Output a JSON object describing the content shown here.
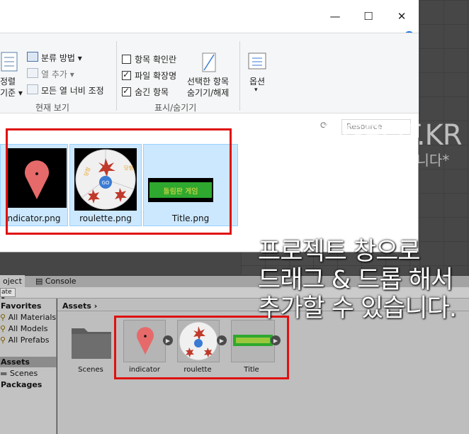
{
  "window": {
    "minimize": "—",
    "maximize": "☐",
    "close": "✕",
    "help": "?",
    "chevron": "∨"
  },
  "ribbon": {
    "sort_label_1": "정렬",
    "sort_label_2": "기준 ▾",
    "group_by": "분류 방법 ▾",
    "add_column": "열 추가 ▾",
    "fit_columns": "모든 열 너비 조정",
    "current_view": "현재 보기",
    "item_checkboxes": "항목 확인란",
    "file_extensions": "파일 확장명",
    "hidden_items": "숨긴 항목",
    "hide_selected_1": "선택한 항목",
    "hide_selected_2": "숨기기/해제",
    "show_hide": "표시/숨기기",
    "options": "옵션",
    "options_arrow": "▾"
  },
  "checkboxes": {
    "item_checkboxes": false,
    "file_extensions": true,
    "hidden_items": true
  },
  "search": {
    "placeholder": "Resource"
  },
  "files": [
    {
      "name": "ndicator.png"
    },
    {
      "name": "roulette.png"
    },
    {
      "name": "Title.png"
    }
  ],
  "roulette": {
    "center": "GO",
    "title": "돌림판 게임"
  },
  "watermark": {
    "line1": "CODINGBOT.KR",
    "line2": "*이미지 무단 사용을 금지합니다*"
  },
  "overlay": {
    "line1": "프로젝트 창으로",
    "line2": "드래그 & 드롭 해서",
    "line3": "추가할 수 있습니다."
  },
  "unity": {
    "tab_project": "oject",
    "tab_console": "Console",
    "create": "ate ▾",
    "favorites": "Favorites",
    "all_materials": "All Materials",
    "all_models": "All Models",
    "all_prefabs": "All Prefabs",
    "assets_side": "Assets",
    "scenes_side": "Scenes",
    "packages": "Packages",
    "breadcrumb": "Assets",
    "breadcrumb_arrow": "›",
    "assets": [
      {
        "name": "Scenes"
      },
      {
        "name": "indicator"
      },
      {
        "name": "roulette"
      },
      {
        "name": "Title"
      }
    ]
  },
  "colors": {
    "highlight": "#e01010",
    "selection": "#cce8ff",
    "unity_panel": "#c2c2c2"
  }
}
